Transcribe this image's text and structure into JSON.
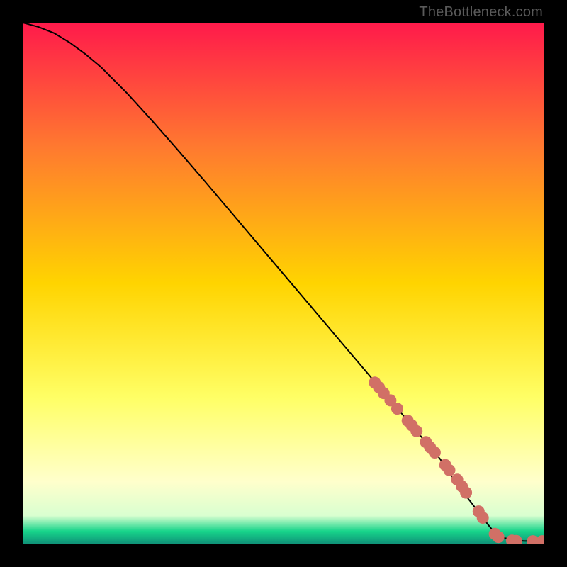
{
  "watermark": "TheBottleneck.com",
  "colors": {
    "gradient_top": "#ff1a4b",
    "gradient_mid1": "#ff7a2f",
    "gradient_mid2": "#ffd400",
    "gradient_mid3": "#ffff66",
    "gradient_mid4": "#ffffcc",
    "gradient_bottom_band_light": "#d9ffd0",
    "gradient_bottom_band_green": "#17d48a",
    "gradient_bottom_band_teal": "#0f8f77",
    "curve": "#000000",
    "marker": "#d17066",
    "marker_stroke": "#a85850",
    "background": "#000000"
  },
  "chart_data": {
    "type": "line",
    "title": "",
    "xlabel": "",
    "ylabel": "",
    "xlim": [
      0,
      100
    ],
    "ylim": [
      0,
      100
    ],
    "curve": {
      "x": [
        0,
        3,
        6,
        9,
        12,
        15,
        20,
        25,
        30,
        35,
        40,
        45,
        50,
        55,
        60,
        65,
        70,
        75,
        80,
        84,
        86,
        88,
        90,
        92,
        94,
        96,
        98,
        100
      ],
      "y": [
        100,
        99.2,
        98,
        96.2,
        94,
        91.5,
        86.5,
        81,
        75.3,
        69.5,
        63.6,
        57.7,
        51.8,
        45.9,
        40,
        34.1,
        28.2,
        22.3,
        16.4,
        10.5,
        8,
        5.3,
        2.8,
        1.3,
        0.8,
        0.65,
        0.6,
        0.6
      ]
    },
    "markers": [
      {
        "x": 67.5,
        "y": 31.0
      },
      {
        "x": 68.3,
        "y": 30.1
      },
      {
        "x": 69.2,
        "y": 29.0
      },
      {
        "x": 70.5,
        "y": 27.6
      },
      {
        "x": 71.8,
        "y": 26.0
      },
      {
        "x": 73.8,
        "y": 23.7
      },
      {
        "x": 74.6,
        "y": 22.8
      },
      {
        "x": 75.5,
        "y": 21.7
      },
      {
        "x": 77.3,
        "y": 19.6
      },
      {
        "x": 78.1,
        "y": 18.6
      },
      {
        "x": 79.0,
        "y": 17.6
      },
      {
        "x": 81.0,
        "y": 15.2
      },
      {
        "x": 81.8,
        "y": 14.2
      },
      {
        "x": 83.3,
        "y": 12.4
      },
      {
        "x": 84.2,
        "y": 11.1
      },
      {
        "x": 85.0,
        "y": 9.9
      },
      {
        "x": 87.4,
        "y": 6.3
      },
      {
        "x": 88.2,
        "y": 5.1
      },
      {
        "x": 90.5,
        "y": 2.0
      },
      {
        "x": 91.2,
        "y": 1.4
      },
      {
        "x": 93.8,
        "y": 0.7
      },
      {
        "x": 94.6,
        "y": 0.65
      },
      {
        "x": 97.8,
        "y": 0.6
      },
      {
        "x": 99.6,
        "y": 0.6
      },
      {
        "x": 100.4,
        "y": 0.6
      }
    ]
  }
}
